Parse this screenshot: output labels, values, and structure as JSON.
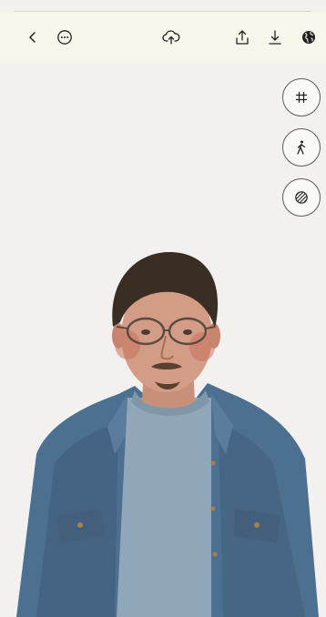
{
  "toolbar": {
    "icons": [
      "back-icon",
      "more-icon",
      "cloud-upload-icon",
      "share-icon",
      "download-icon",
      "globe-icon"
    ]
  },
  "viewport_tools": {
    "icons": [
      "grid-icon",
      "walking-person-icon",
      "texture-sphere-icon"
    ]
  },
  "colors": {
    "toolbar_bg": "#f8f5ea",
    "viewport_bg": "#f2f1ef",
    "denim": "#4d6f90",
    "sweater": "#8fa7b8",
    "hair": "#3a2e24"
  }
}
